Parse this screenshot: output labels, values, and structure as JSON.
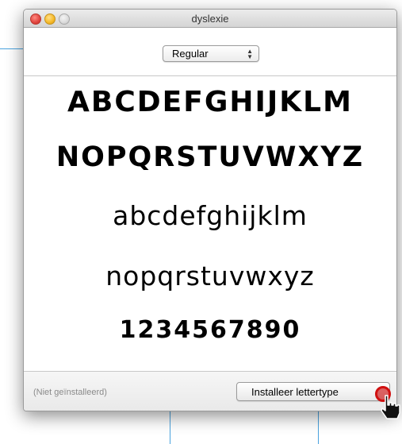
{
  "window": {
    "title": "dyslexie"
  },
  "toolbar": {
    "style_select": {
      "value": "Regular"
    }
  },
  "preview": {
    "lines": [
      "ABCDEFGHIJKLM",
      "NOPQRSTUVWXYZ",
      "abcdefghijklm",
      "nopqrstuvwxyz",
      "1234567890"
    ]
  },
  "footer": {
    "status": "(Niet geïnstalleerd)",
    "install_label": "Installeer lettertype"
  },
  "icons": {
    "close": "close-icon",
    "minimize": "minimize-icon",
    "maximize": "zoom-icon",
    "popup_arrows": "up-down-arrows-icon",
    "cursor": "hand-cursor-icon"
  },
  "colors": {
    "accent_line": "#4aa3df",
    "click_highlight": "#d01010",
    "close": "#e0443e",
    "minimize": "#f5b826"
  }
}
